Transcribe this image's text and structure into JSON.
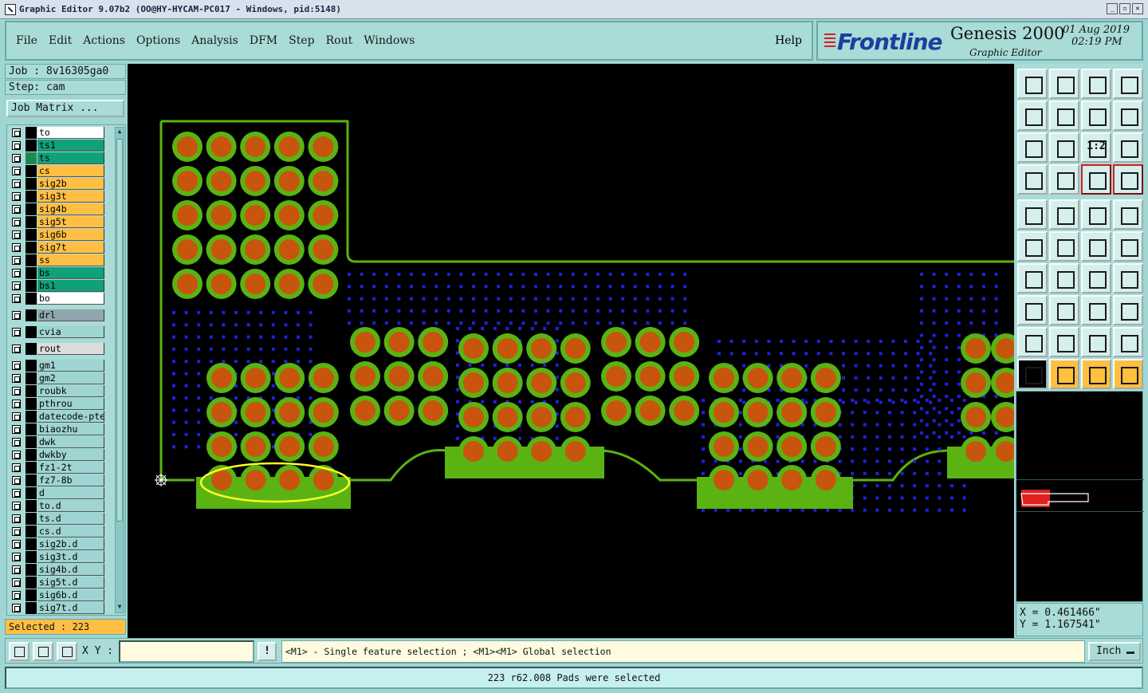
{
  "window": {
    "title": "Graphic Editor 9.07b2 (OO@HY-HYCAM-PC017 - Windows, pid:5148)",
    "controls": [
      "minimize",
      "restore",
      "close"
    ]
  },
  "menu": {
    "items": [
      "File",
      "Edit",
      "Actions",
      "Options",
      "Analysis",
      "DFM",
      "Step",
      "Rout",
      "Windows"
    ],
    "help": "Help"
  },
  "brand": {
    "logo": "Frontline",
    "product": "Genesis 2000",
    "subtitle": "Graphic Editor",
    "date": "01 Aug 2019",
    "time": "02:19 PM"
  },
  "job": {
    "job_label": "Job : 8v16305ga0",
    "step_label": "Step: cam",
    "matrix_button": "Job Matrix ..."
  },
  "layers": [
    {
      "name": "to",
      "cls": "c-board",
      "affected": false
    },
    {
      "name": "ts1",
      "cls": "c-green",
      "affected": false
    },
    {
      "name": "ts",
      "cls": "c-green",
      "affected": true
    },
    {
      "name": "cs",
      "cls": "c-orange",
      "affected": false
    },
    {
      "name": "sig2b",
      "cls": "c-orange",
      "affected": false
    },
    {
      "name": "sig3t",
      "cls": "c-orange",
      "affected": false
    },
    {
      "name": "sig4b",
      "cls": "c-orange",
      "affected": false
    },
    {
      "name": "sig5t",
      "cls": "c-orange",
      "affected": false
    },
    {
      "name": "sig6b",
      "cls": "c-orange",
      "affected": false
    },
    {
      "name": "sig7t",
      "cls": "c-orange",
      "affected": false
    },
    {
      "name": "ss",
      "cls": "c-orange",
      "affected": false
    },
    {
      "name": "bs",
      "cls": "c-green",
      "affected": false
    },
    {
      "name": "bs1",
      "cls": "c-green",
      "affected": false
    },
    {
      "name": "bo",
      "cls": "c-board",
      "affected": false
    },
    {
      "name": "drl",
      "cls": "c-drill",
      "affected": false,
      "gap": true
    },
    {
      "name": "cvia",
      "cls": "c-misc",
      "affected": false,
      "gap": true
    },
    {
      "name": "rout",
      "cls": "c-rout",
      "affected": false,
      "gap": true
    },
    {
      "name": "gm1",
      "cls": "c-misc",
      "affected": false,
      "gap": true
    },
    {
      "name": "gm2",
      "cls": "c-misc",
      "affected": false
    },
    {
      "name": "roubk",
      "cls": "c-misc",
      "affected": false
    },
    {
      "name": "pthrou",
      "cls": "c-misc",
      "affected": false
    },
    {
      "name": "datecode-pte",
      "cls": "c-misc",
      "affected": false
    },
    {
      "name": "biaozhu",
      "cls": "c-misc",
      "affected": false
    },
    {
      "name": "dwk",
      "cls": "c-misc",
      "affected": false
    },
    {
      "name": "dwkby",
      "cls": "c-misc",
      "affected": false
    },
    {
      "name": "fz1-2t",
      "cls": "c-misc",
      "affected": false
    },
    {
      "name": "fz7-8b",
      "cls": "c-misc",
      "affected": false
    },
    {
      "name": "d",
      "cls": "c-misc",
      "affected": false
    },
    {
      "name": "to.d",
      "cls": "c-misc",
      "affected": false
    },
    {
      "name": "ts.d",
      "cls": "c-misc",
      "affected": false
    },
    {
      "name": "cs.d",
      "cls": "c-misc",
      "affected": false
    },
    {
      "name": "sig2b.d",
      "cls": "c-misc",
      "affected": false
    },
    {
      "name": "sig3t.d",
      "cls": "c-misc",
      "affected": false
    },
    {
      "name": "sig4b.d",
      "cls": "c-misc",
      "affected": false
    },
    {
      "name": "sig5t.d",
      "cls": "c-misc",
      "affected": false
    },
    {
      "name": "sig6b.d",
      "cls": "c-misc",
      "affected": false
    },
    {
      "name": "sig7t.d",
      "cls": "c-misc",
      "affected": false
    }
  ],
  "selected_label": "Selected : 223",
  "coords": {
    "x": "X = 0.461466\"",
    "y": "Y = 1.167541\""
  },
  "bottom": {
    "xy_label": "X Y :",
    "xy_value": "",
    "bang": "!",
    "hint": "<M1> - Single feature selection ; <M1><M1> Global selection",
    "units": "Inch"
  },
  "status": "223 r62.008 Pads were selected",
  "tools": {
    "labels": [
      "",
      "",
      "",
      "",
      "",
      "",
      "",
      "?",
      "",
      "",
      "",
      "",
      "",
      "",
      "",
      "",
      "",
      "",
      "",
      "",
      "",
      "",
      "",
      "",
      "",
      "",
      "",
      "",
      "",
      "",
      "",
      "",
      ""
    ],
    "ratio_label": "1:2"
  },
  "colors": {
    "board_fill": "#000000",
    "copper": "#5ab313",
    "pad_center": "#c8550d",
    "via": "#1e22d8",
    "highlight": "#ffff22",
    "panel_bg": "#a9dbd7",
    "orange_layer": "#ffbf45",
    "green_layer": "#10a07a"
  }
}
